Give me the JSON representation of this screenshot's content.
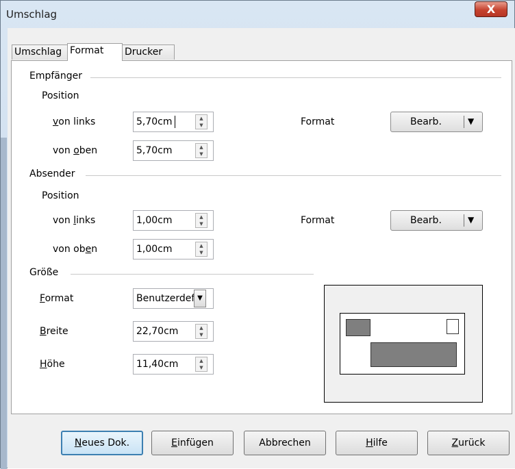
{
  "window": {
    "title": "Umschlag",
    "close_glyph": "X"
  },
  "tabs": [
    {
      "label": "Umschlag"
    },
    {
      "label": "Format",
      "active": true
    },
    {
      "label": "Drucker"
    }
  ],
  "recipient": {
    "heading": "Empfänger",
    "position_label": "Position",
    "left_label_pre": "",
    "left_label_key": "v",
    "left_label_post": "on links",
    "left_value": "5,70cm",
    "top_label_pre": "von ",
    "top_label_key": "o",
    "top_label_post": "ben",
    "top_value": "5,70cm",
    "format_label": "Format",
    "edit_button": "Bearb."
  },
  "sender": {
    "heading": "Absender",
    "position_label": "Position",
    "left_label_pre": "von ",
    "left_label_key": "l",
    "left_label_post": "inks",
    "left_value": "1,00cm",
    "top_label_pre": "von ob",
    "top_label_key": "e",
    "top_label_post": "n",
    "top_value": "1,00cm",
    "format_label": "Format",
    "edit_button": "Bearb."
  },
  "size": {
    "heading": "Größe",
    "format_key": "F",
    "format_rest": "ormat",
    "format_value": "Benutzerdefiniert",
    "width_key": "B",
    "width_rest": "reite",
    "width_value": "22,70cm",
    "height_key": "H",
    "height_rest": "öhe",
    "height_value": "11,40cm"
  },
  "buttons": {
    "new_doc_key": "N",
    "new_doc_rest": "eues Dok.",
    "insert_key": "E",
    "insert_rest": "infügen",
    "cancel": "Abbrechen",
    "help_key": "H",
    "help_rest": "ilfe",
    "back_key": "Z",
    "back_rest": "urück"
  },
  "icons": {
    "spin_up": "▲",
    "spin_down": "▼",
    "dropdown": "▼"
  }
}
